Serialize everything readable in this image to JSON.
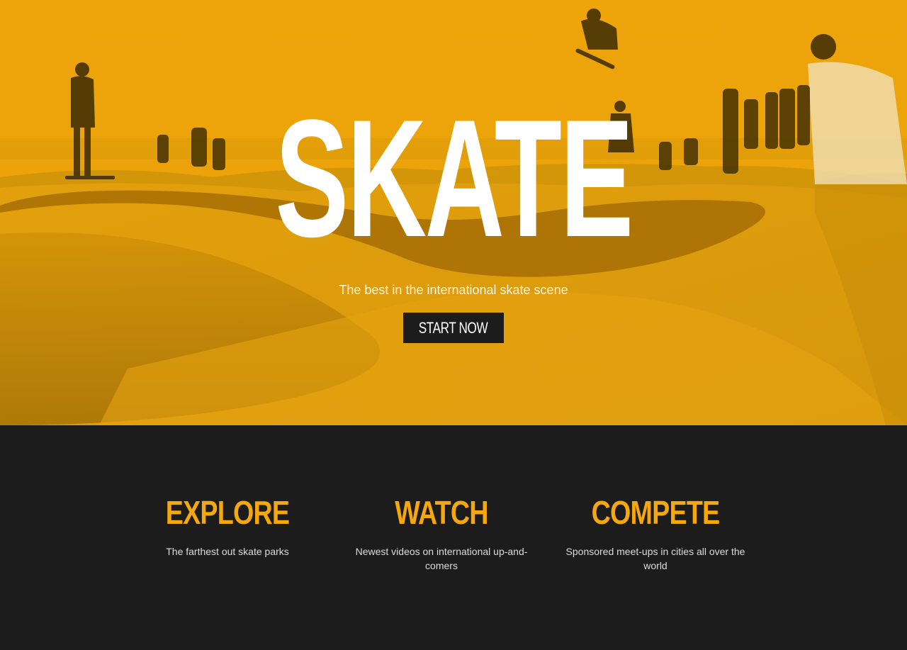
{
  "hero": {
    "title": "SKATE",
    "subtitle": "The best in the international skate scene",
    "cta_label": "START NOW",
    "overlay_color": "#e8a105"
  },
  "features": [
    {
      "title": "EXPLORE",
      "text": "The farthest out skate parks"
    },
    {
      "title": "WATCH",
      "text": "Newest videos on international up-and-comers"
    },
    {
      "title": "COMPETE",
      "text": "Sponsored meet-ups in cities all over the world"
    }
  ],
  "colors": {
    "accent": "#f5a70e",
    "dark": "#1c1c1c",
    "white": "#ffffff"
  }
}
